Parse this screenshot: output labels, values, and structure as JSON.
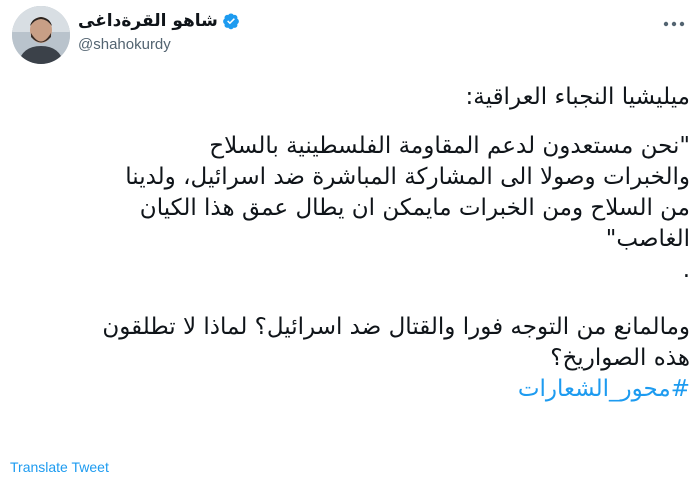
{
  "author": {
    "display_name": "شاهو القرةداغی",
    "handle": "@shahokurdy",
    "verified": true
  },
  "tweet": {
    "line1": "ميليشيا النجباء العراقية:",
    "quote_lines": [
      "\"نحن مستعدون لدعم المقاومة الفلسطينية بالسلاح",
      "والخبرات وصولا الى المشاركة المباشرة ضد اسرائيل، ولدينا",
      "من السلاح ومن الخبرات مايمكن ان يطال عمق هذا الكيان",
      "الغاصب\"",
      "."
    ],
    "question_lines": [
      "ومالمانع من التوجه فورا والقتال ضد اسرائيل؟ لماذا لا تطلقون",
      "هذه الصواريخ؟"
    ],
    "hashtag": "#محور_الشعارات"
  },
  "actions": {
    "translate_label": "Translate Tweet"
  },
  "icons": {
    "verified": "verified-badge-icon",
    "more": "more-options-icon"
  },
  "colors": {
    "accent": "#1d9bf0",
    "text": "#0f1419",
    "secondary": "#536471"
  }
}
